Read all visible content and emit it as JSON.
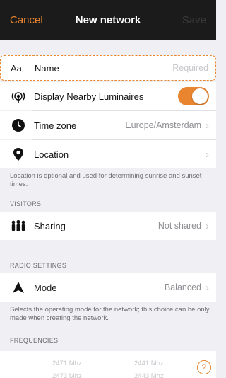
{
  "navbar": {
    "cancel_label": "Cancel",
    "title": "New network",
    "save_label": "Save"
  },
  "name_row": {
    "icon_text": "Aa",
    "label": "Name",
    "placeholder": "Required"
  },
  "display_row": {
    "icon": "broadcast-icon",
    "label": "Display Nearby Luminaires",
    "toggle_on": true
  },
  "timezone_row": {
    "icon": "clock-icon",
    "label": "Time zone",
    "value": "Europe/Amsterdam"
  },
  "location_row": {
    "icon": "location-pin-icon",
    "label": "Location",
    "value": ""
  },
  "location_note": "Location is optional and used for determining sunrise and sunset times.",
  "visitors": {
    "header": "VISITORS",
    "sharing_label": "Sharing",
    "sharing_value": "Not shared",
    "icon": "people-icon"
  },
  "radio": {
    "header": "RADIO SETTINGS",
    "mode_label": "Mode",
    "mode_value": "Balanced",
    "icon": "mode-icon",
    "note": "Selects the operating mode for the network; this choice can be only made when creating the network."
  },
  "frequencies": {
    "header": "FREQUENCIES",
    "items": [
      "2471 Mhz",
      "2441 Mhz",
      "2473 Mhz",
      "2443 Mhz"
    ]
  },
  "help": {
    "label": "?"
  },
  "colors": {
    "accent": "#e9852e",
    "navbar": "#1b1b1b",
    "background": "#efeff4"
  }
}
